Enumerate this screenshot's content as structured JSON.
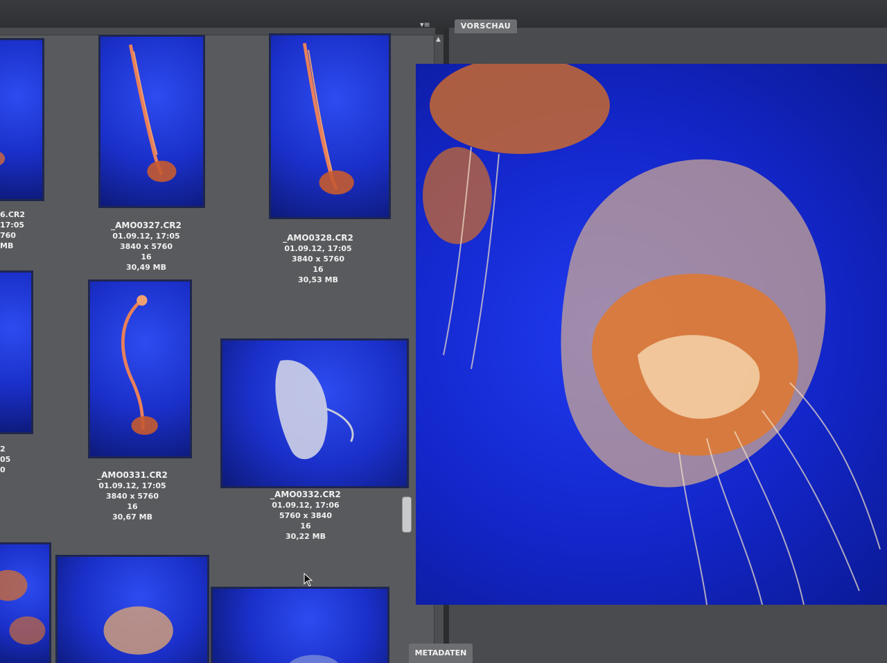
{
  "panels": {
    "preview_tab": "VORSCHAU",
    "metadata_tab": "METADATEN"
  },
  "thumbnails": [
    {
      "file": "_AMO0327.CR2",
      "date": "01.09.12, 17:05",
      "dims": "3840 x 5760",
      "depth": "16",
      "size": "30,49 MB"
    },
    {
      "file": "_AMO0328.CR2",
      "date": "01.09.12, 17:05",
      "dims": "3840 x 5760",
      "depth": "16",
      "size": "30,53 MB"
    },
    {
      "file": "_AMO0331.CR2",
      "date": "01.09.12, 17:05",
      "dims": "3840 x 5760",
      "depth": "16",
      "size": "30,67 MB"
    },
    {
      "file": "_AMO0332.CR2",
      "date": "01.09.12, 17:06",
      "dims": "5760 x 3840",
      "depth": "16",
      "size": "30,22 MB"
    }
  ],
  "partial_left": {
    "row1": [
      "6.CR2",
      "17:05",
      "760",
      "",
      "MB"
    ],
    "row2": [
      "2",
      "05",
      "0"
    ]
  },
  "icons": {
    "panel_menu": "list-menu-icon",
    "scroll_up": "scroll-up-arrow-icon",
    "cursor": "mouse-pointer-icon"
  },
  "colors": {
    "panel_bg": "#595a5d",
    "preview_bg": "#1326c9",
    "jelly_orange": "#e0782e"
  }
}
